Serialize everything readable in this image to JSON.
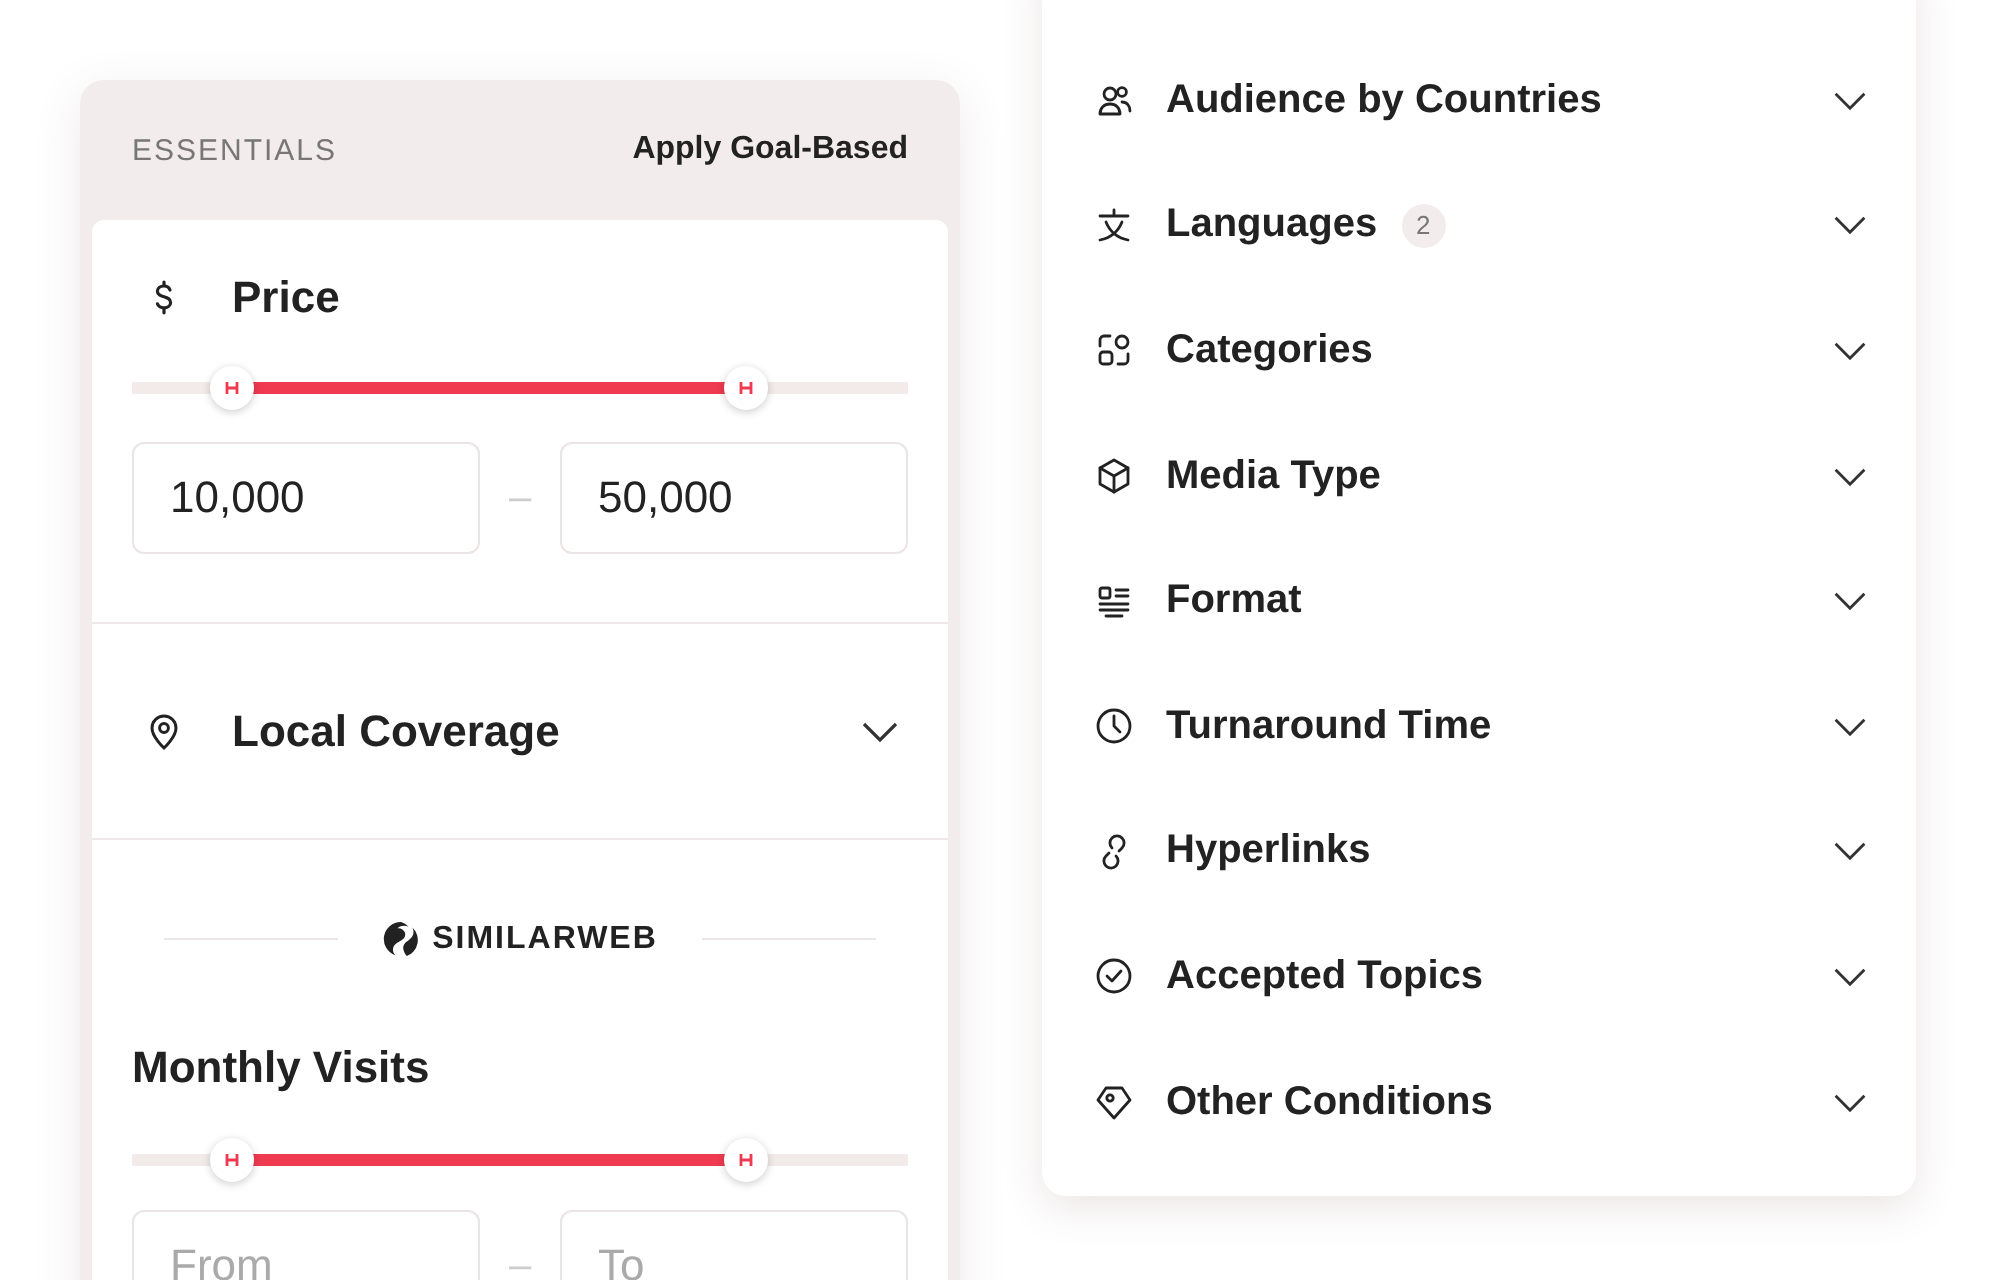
{
  "essentials_panel": {
    "heading": "ESSENTIALS",
    "action": "Apply Goal-Based",
    "price": {
      "title": "Price",
      "handles": [
        {
          "level": 0.13
        },
        {
          "level": 0.79
        }
      ],
      "from": {
        "value": "10,000"
      },
      "separator": "–",
      "to": {
        "value": "50,000"
      }
    },
    "local_coverage": {
      "title": "Local Coverage",
      "expanded": false
    },
    "similarweb": {
      "brand": "SIMILARWEB",
      "title": "Monthly Visits",
      "handles": [
        {
          "level": 0.13
        },
        {
          "level": 0.79
        }
      ],
      "from": {
        "placeholder": "From"
      },
      "separator": "–",
      "to": {
        "placeholder": "To"
      }
    }
  },
  "filters": [
    {
      "label": "Audience by Countries",
      "expanded": false
    },
    {
      "label": "Languages",
      "badge": "2",
      "expanded": false
    },
    {
      "label": "Categories",
      "expanded": false
    },
    {
      "label": "Media Type",
      "expanded": false
    },
    {
      "label": "Format",
      "expanded": false
    },
    {
      "label": "Turnaround Time",
      "expanded": false
    },
    {
      "label": "Hyperlinks",
      "expanded": false
    },
    {
      "label": "Accepted Topics",
      "expanded": false
    },
    {
      "label": "Other Conditions",
      "expanded": false
    }
  ]
}
